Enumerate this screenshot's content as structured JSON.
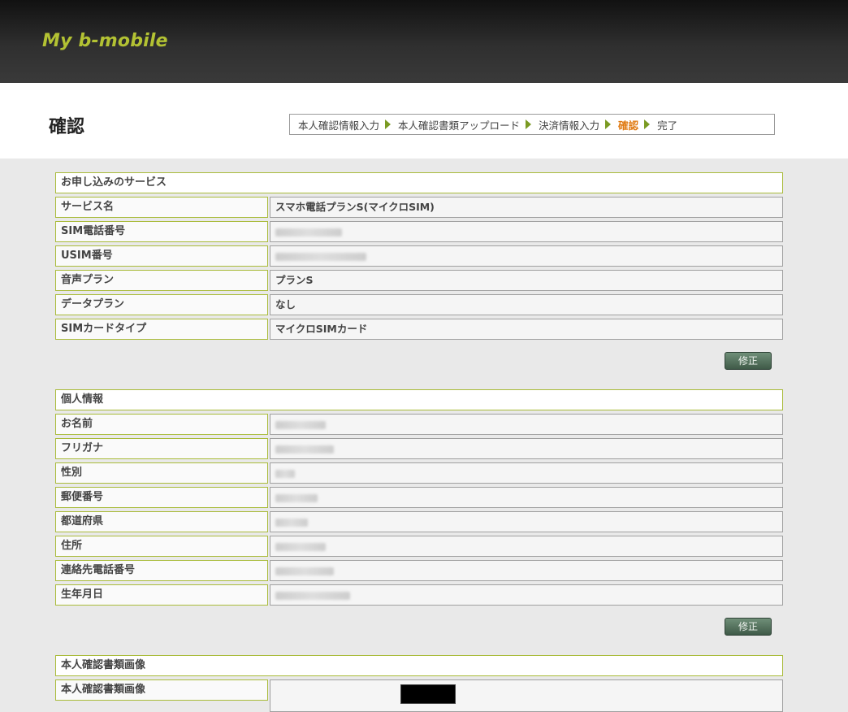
{
  "header": {
    "logo": "My b-mobile"
  },
  "page": {
    "title": "確認"
  },
  "steps": [
    {
      "label": "本人確認情報入力",
      "active": false
    },
    {
      "label": "本人確認書類アップロード",
      "active": false
    },
    {
      "label": "決済情報入力",
      "active": false
    },
    {
      "label": "確認",
      "active": true
    },
    {
      "label": "完了",
      "active": false
    }
  ],
  "colors": {
    "accent_active": "#e07a12",
    "border_green": "#a9bb3a",
    "logo": "#b3c233",
    "button": "#4f6b58"
  },
  "service": {
    "heading": "お申し込みのサービス",
    "rows": [
      {
        "label": "サービス名",
        "value": "スマホ電話プランS(マイクロSIM)"
      },
      {
        "label": "SIM電話番号",
        "value": ""
      },
      {
        "label": "USIM番号",
        "value": ""
      },
      {
        "label": "音声プラン",
        "value": "プランS"
      },
      {
        "label": "データプラン",
        "value": "なし"
      },
      {
        "label": "SIMカードタイプ",
        "value": "マイクロSIMカード"
      }
    ],
    "edit_label": "修正"
  },
  "personal": {
    "heading": "個人情報",
    "rows": [
      {
        "label": "お名前",
        "value": ""
      },
      {
        "label": "フリガナ",
        "value": ""
      },
      {
        "label": "性別",
        "value": ""
      },
      {
        "label": "郵便番号",
        "value": ""
      },
      {
        "label": "都道府県",
        "value": ""
      },
      {
        "label": "住所",
        "value": ""
      },
      {
        "label": "連絡先電話番号",
        "value": ""
      },
      {
        "label": "生年月日",
        "value": ""
      }
    ],
    "edit_label": "修正"
  },
  "idcheck": {
    "heading": "本人確認書類画像",
    "rows": [
      {
        "label": "本人確認書類画像"
      }
    ]
  }
}
